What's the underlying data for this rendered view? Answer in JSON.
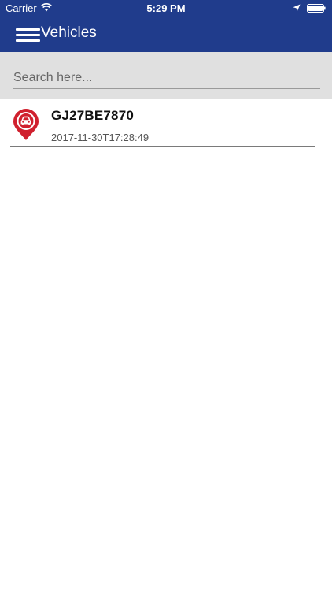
{
  "status_bar": {
    "carrier": "Carrier",
    "time": "5:29 PM",
    "icons": [
      "wifi-icon",
      "location-arrow-icon",
      "battery-icon"
    ]
  },
  "nav": {
    "menu_icon": "hamburger-menu-icon",
    "title": "Vehicles"
  },
  "search": {
    "placeholder": "Search here...",
    "value": ""
  },
  "vehicles": [
    {
      "plate": "GJ27BE7870",
      "timestamp": "2017-11-30T17:28:49",
      "icon": "car-location-pin-icon"
    }
  ],
  "colors": {
    "header": "#203c8c",
    "search_bg": "#e0e0e0",
    "pin_red": "#d0202e"
  }
}
